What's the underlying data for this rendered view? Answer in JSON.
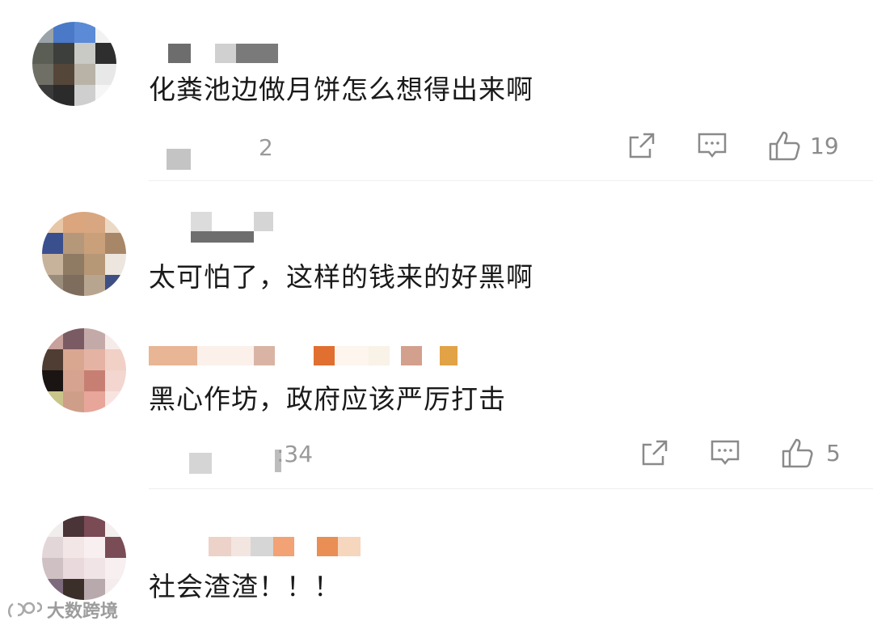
{
  "comments": [
    {
      "text": "化粪池边做月饼怎么想得出来啊",
      "time": "2",
      "reply_count": "",
      "like_count": "19"
    },
    {
      "text": "太可怕了，这样的钱来的好黑啊",
      "time": "",
      "like_count": ""
    },
    {
      "text": "黑心作坊，政府应该严厉打击",
      "time": ":34",
      "like_count": "5"
    },
    {
      "text": "社会渣渣！！！",
      "time": "",
      "like_count": ""
    }
  ],
  "watermark": {
    "text": "大数跨境"
  },
  "icons": [
    "share-icon",
    "reply-icon",
    "like-icon"
  ]
}
